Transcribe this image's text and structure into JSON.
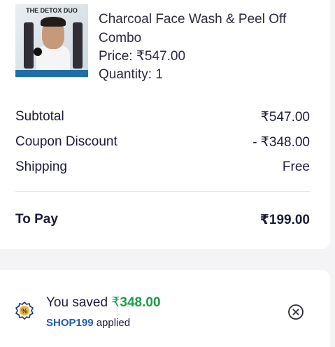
{
  "product": {
    "image_banner_text": "THE DETOX DUO",
    "name": "Charcoal Face Wash & Peel Off Combo",
    "price_text": "Price: ₹547.00",
    "quantity_text": "Quantity: 1"
  },
  "summary": {
    "subtotal_label": "Subtotal",
    "subtotal_value": "₹547.00",
    "coupon_label": "Coupon Discount",
    "coupon_value": "- ₹348.00",
    "shipping_label": "Shipping",
    "shipping_value": "Free",
    "topay_label": "To Pay",
    "topay_value": "₹199.00"
  },
  "coupon": {
    "saved_prefix": "You saved ",
    "saved_currency": "₹",
    "saved_amount": "348.00",
    "code": "SHOP199",
    "applied_text": " applied"
  },
  "colors": {
    "accent_green": "#1f9a4a",
    "accent_blue": "#1f5fa8",
    "coupon_icon": "#e0a42a"
  }
}
